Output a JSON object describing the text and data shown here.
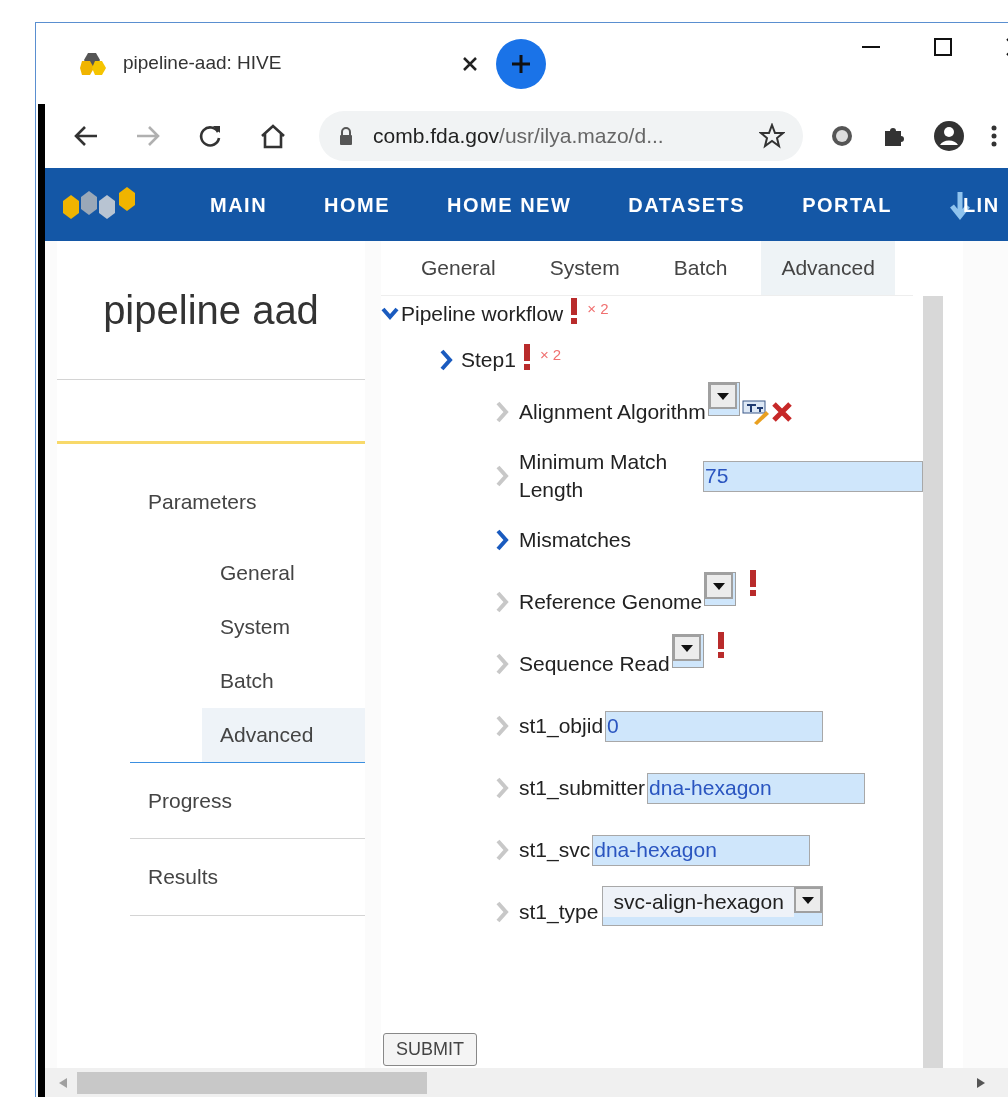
{
  "browser_tab": {
    "title": "pipeline-aad: HIVE"
  },
  "address_bar": {
    "host": "comb.fda.gov",
    "path": "/usr/ilya.mazo/d..."
  },
  "nav": {
    "items": [
      "MAIN",
      "HOME",
      "HOME NEW",
      "DATASETS",
      "PORTAL",
      "LIN"
    ]
  },
  "sidebar": {
    "title": "pipeline aad",
    "items": [
      {
        "label": "Parameters",
        "selected": false,
        "children": [
          {
            "label": "General",
            "selected": false
          },
          {
            "label": "System",
            "selected": false
          },
          {
            "label": "Batch",
            "selected": false
          },
          {
            "label": "Advanced",
            "selected": true
          }
        ]
      },
      {
        "label": "Progress",
        "selected": false
      },
      {
        "label": "Results",
        "selected": false
      }
    ]
  },
  "tabs": [
    {
      "label": "General",
      "selected": false
    },
    {
      "label": "System",
      "selected": false
    },
    {
      "label": "Batch",
      "selected": false
    },
    {
      "label": "Advanced",
      "selected": true
    }
  ],
  "tree": {
    "label": "Pipeline workflow",
    "expanded": true,
    "error": true,
    "error_count": "× 2",
    "step": {
      "label": "Step1",
      "expanded": false,
      "error": true,
      "error_count": "× 2",
      "params": [
        {
          "kind": "dropdown",
          "label": "Alignment Algorithm",
          "error": false,
          "edit_tools": true
        },
        {
          "kind": "text",
          "label": "Minimum Match Length",
          "value": "75",
          "error": false
        },
        {
          "kind": "group",
          "label": "Mismatches",
          "error": false
        },
        {
          "kind": "dropdown",
          "label": "Reference Genome",
          "error": true,
          "edit_tools": false
        },
        {
          "kind": "dropdown",
          "label": "Sequence Read",
          "error": true,
          "edit_tools": false
        },
        {
          "kind": "text",
          "label": "st1_objid",
          "value": "0",
          "error": false
        },
        {
          "kind": "text",
          "label": "st1_submitter",
          "value": "dna-hexagon",
          "error": false
        },
        {
          "kind": "text",
          "label": "st1_svc",
          "value": "dna-hexagon",
          "error": false
        },
        {
          "kind": "select",
          "label": "st1_type",
          "value": "svc-align-hexagon",
          "error": false
        }
      ]
    }
  },
  "submit_button": "SUBMIT"
}
